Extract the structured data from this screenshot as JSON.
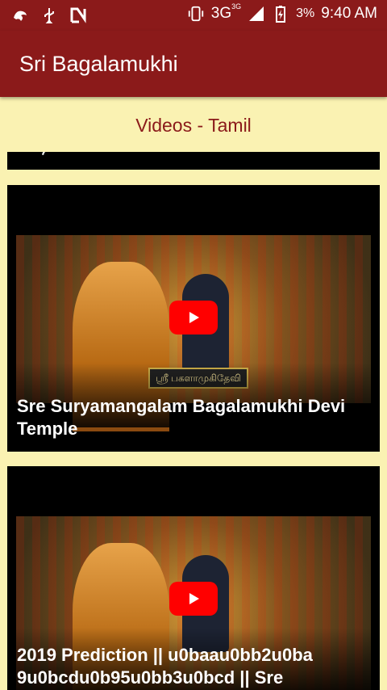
{
  "status_bar": {
    "network": "3G",
    "network_sup": "3G",
    "battery": "3%",
    "time": "9:40 AM",
    "icons": [
      "bird-icon",
      "usb-icon",
      "n-icon",
      "vibrate-icon",
      "signal-icon",
      "battery-charging-icon"
    ]
  },
  "app": {
    "title": "Sri Bagalamukhi"
  },
  "section": {
    "title": "Videos - Tamil"
  },
  "videos": [
    {
      "title": "சஂகர காட்சி"
    },
    {
      "title": "Sre Suryamangalam Bagalamukhi Devi Temple"
    },
    {
      "title": "2019 Prediction || u0baau0bb2u0ba 9u0bcdu0b95u0bb3u0bcd || Sre"
    }
  ],
  "colors": {
    "primary": "#8B1A1A",
    "background": "#FAF2B2",
    "play": "#FF0000"
  }
}
